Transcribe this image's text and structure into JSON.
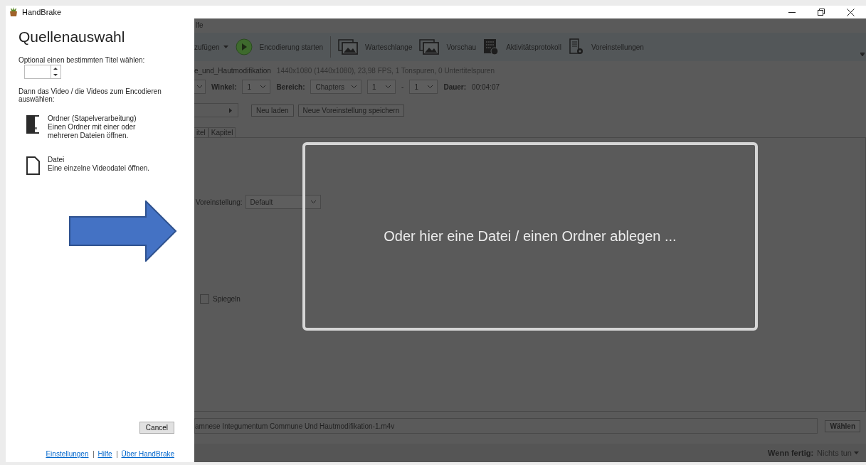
{
  "window": {
    "title": "HandBrake"
  },
  "source_panel": {
    "heading": "Quellenauswahl",
    "title_prompt": "Optional einen bestimmten Titel wählen:",
    "videos_prompt": "Dann das Video / die Videos zum Encodieren auswählen:",
    "options": [
      {
        "kind": "folder",
        "title": "Ordner (Stapelverarbeitung)",
        "description": "Einen Ordner mit einer oder mehreren Dateien öffnen."
      },
      {
        "kind": "file",
        "title": "Datei",
        "description": "Eine einzelne Videodatei öffnen."
      }
    ],
    "cancel_button": "Cancel",
    "links": [
      "Einstellungen",
      "Hilfe",
      "Über HandBrake"
    ]
  },
  "main": {
    "menu_fragment": "lfe",
    "toolbar": [
      {
        "kind": "dropdown",
        "label": "zufügen"
      },
      {
        "kind": "start",
        "label": "Encodierung starten"
      },
      {
        "kind": "queue",
        "label": "Warteschlange"
      },
      {
        "kind": "preview",
        "label": "Vorschau"
      },
      {
        "kind": "log",
        "label": "Aktivitätsprotokoll"
      },
      {
        "kind": "presets",
        "label": "Voreinstellungen"
      }
    ],
    "source": {
      "name": "e_und_Hautmodifikation",
      "info": "1440x1080 (1440x1080), 23,98 FPS, 1 Tonspuren, 0 Untertitelspuren"
    },
    "range_row": [
      {
        "kind": "dropdown"
      },
      {
        "kind": "label",
        "text": "Winkel:"
      },
      {
        "kind": "dropdown",
        "value": "1"
      },
      {
        "kind": "label",
        "text": "Bereich:"
      },
      {
        "kind": "dropdown",
        "value": "Chapters"
      },
      {
        "kind": "dropdown",
        "value": "1"
      },
      {
        "kind": "text",
        "text": "-"
      },
      {
        "kind": "dropdown",
        "value": "1"
      },
      {
        "kind": "label",
        "text": "Dauer:"
      },
      {
        "kind": "text",
        "text": "00:04:07"
      }
    ],
    "preset_buttons": [
      "Neu laden",
      "Neue Voreinstellung speichern"
    ],
    "tabs": [
      {
        "label": "itel",
        "selected": false
      },
      {
        "label": "Kapitel",
        "selected": false
      }
    ],
    "preset_field": {
      "label": "Voreinstellung:",
      "value": "Default"
    },
    "flip_checkbox": {
      "label": "Spiegeln",
      "checked": false
    },
    "destination": {
      "value": "amnese Integumentum Commune Und Hautmodifikation-1.m4v",
      "button": "Wählen"
    },
    "when_done": {
      "label": "Wenn fertig:",
      "value": "Nichts tun"
    },
    "drop_zone": "Oder hier eine Datei / einen Ordner ablegen ..."
  }
}
